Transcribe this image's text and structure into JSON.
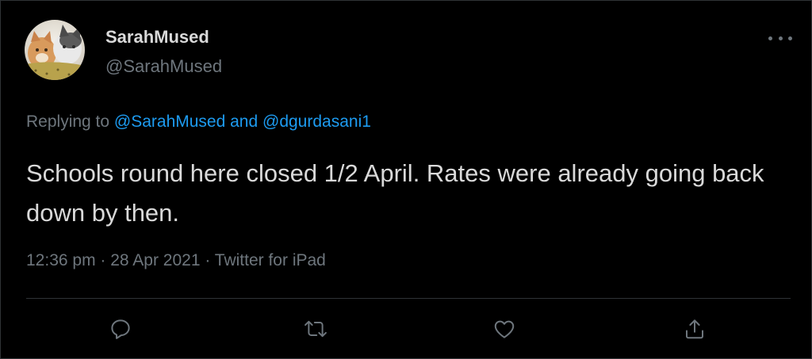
{
  "tweet": {
    "display_name": "SarahMused",
    "handle": "@SarahMused",
    "replying_prefix": "Replying to ",
    "replying_to": "@SarahMused and @dgurdasani1",
    "text": "Schools round here closed 1/2 April. Rates were already going back down by then.",
    "time": "12:36 pm",
    "date": "28 Apr 2021",
    "source": "Twitter for iPad",
    "separator": " · "
  },
  "icons": {
    "more": "more-horizontal-icon",
    "reply": "reply-icon",
    "retweet": "retweet-icon",
    "like": "heart-icon",
    "share": "share-icon"
  },
  "colors": {
    "background": "#000000",
    "text": "#d9d9d9",
    "muted": "#6e767d",
    "link": "#1d9bf0",
    "divider": "#2f3336"
  }
}
